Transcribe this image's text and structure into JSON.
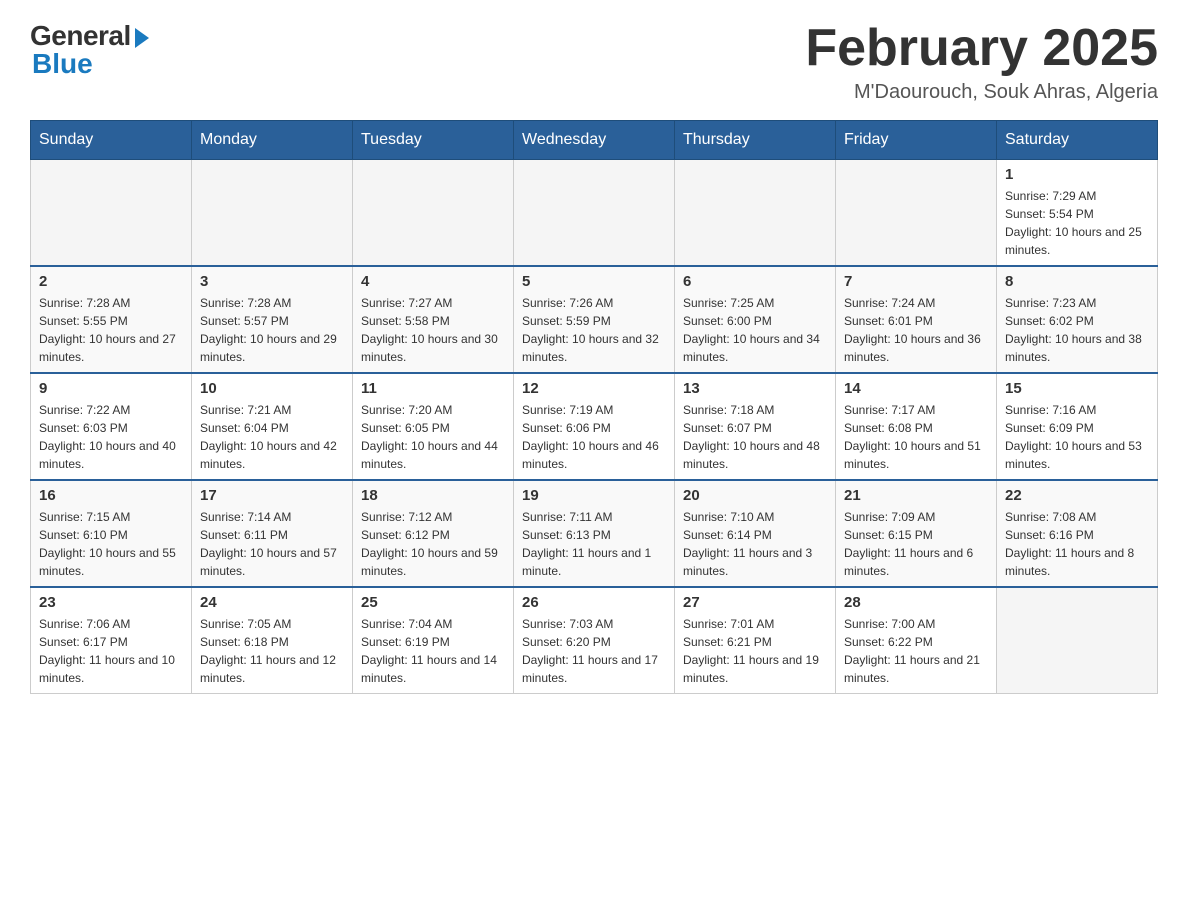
{
  "header": {
    "logo_general": "General",
    "logo_blue": "Blue",
    "main_title": "February 2025",
    "subtitle": "M'Daourouch, Souk Ahras, Algeria"
  },
  "days_of_week": [
    "Sunday",
    "Monday",
    "Tuesday",
    "Wednesday",
    "Thursday",
    "Friday",
    "Saturday"
  ],
  "weeks": [
    [
      {
        "day": "",
        "info": ""
      },
      {
        "day": "",
        "info": ""
      },
      {
        "day": "",
        "info": ""
      },
      {
        "day": "",
        "info": ""
      },
      {
        "day": "",
        "info": ""
      },
      {
        "day": "",
        "info": ""
      },
      {
        "day": "1",
        "info": "Sunrise: 7:29 AM\nSunset: 5:54 PM\nDaylight: 10 hours and 25 minutes."
      }
    ],
    [
      {
        "day": "2",
        "info": "Sunrise: 7:28 AM\nSunset: 5:55 PM\nDaylight: 10 hours and 27 minutes."
      },
      {
        "day": "3",
        "info": "Sunrise: 7:28 AM\nSunset: 5:57 PM\nDaylight: 10 hours and 29 minutes."
      },
      {
        "day": "4",
        "info": "Sunrise: 7:27 AM\nSunset: 5:58 PM\nDaylight: 10 hours and 30 minutes."
      },
      {
        "day": "5",
        "info": "Sunrise: 7:26 AM\nSunset: 5:59 PM\nDaylight: 10 hours and 32 minutes."
      },
      {
        "day": "6",
        "info": "Sunrise: 7:25 AM\nSunset: 6:00 PM\nDaylight: 10 hours and 34 minutes."
      },
      {
        "day": "7",
        "info": "Sunrise: 7:24 AM\nSunset: 6:01 PM\nDaylight: 10 hours and 36 minutes."
      },
      {
        "day": "8",
        "info": "Sunrise: 7:23 AM\nSunset: 6:02 PM\nDaylight: 10 hours and 38 minutes."
      }
    ],
    [
      {
        "day": "9",
        "info": "Sunrise: 7:22 AM\nSunset: 6:03 PM\nDaylight: 10 hours and 40 minutes."
      },
      {
        "day": "10",
        "info": "Sunrise: 7:21 AM\nSunset: 6:04 PM\nDaylight: 10 hours and 42 minutes."
      },
      {
        "day": "11",
        "info": "Sunrise: 7:20 AM\nSunset: 6:05 PM\nDaylight: 10 hours and 44 minutes."
      },
      {
        "day": "12",
        "info": "Sunrise: 7:19 AM\nSunset: 6:06 PM\nDaylight: 10 hours and 46 minutes."
      },
      {
        "day": "13",
        "info": "Sunrise: 7:18 AM\nSunset: 6:07 PM\nDaylight: 10 hours and 48 minutes."
      },
      {
        "day": "14",
        "info": "Sunrise: 7:17 AM\nSunset: 6:08 PM\nDaylight: 10 hours and 51 minutes."
      },
      {
        "day": "15",
        "info": "Sunrise: 7:16 AM\nSunset: 6:09 PM\nDaylight: 10 hours and 53 minutes."
      }
    ],
    [
      {
        "day": "16",
        "info": "Sunrise: 7:15 AM\nSunset: 6:10 PM\nDaylight: 10 hours and 55 minutes."
      },
      {
        "day": "17",
        "info": "Sunrise: 7:14 AM\nSunset: 6:11 PM\nDaylight: 10 hours and 57 minutes."
      },
      {
        "day": "18",
        "info": "Sunrise: 7:12 AM\nSunset: 6:12 PM\nDaylight: 10 hours and 59 minutes."
      },
      {
        "day": "19",
        "info": "Sunrise: 7:11 AM\nSunset: 6:13 PM\nDaylight: 11 hours and 1 minute."
      },
      {
        "day": "20",
        "info": "Sunrise: 7:10 AM\nSunset: 6:14 PM\nDaylight: 11 hours and 3 minutes."
      },
      {
        "day": "21",
        "info": "Sunrise: 7:09 AM\nSunset: 6:15 PM\nDaylight: 11 hours and 6 minutes."
      },
      {
        "day": "22",
        "info": "Sunrise: 7:08 AM\nSunset: 6:16 PM\nDaylight: 11 hours and 8 minutes."
      }
    ],
    [
      {
        "day": "23",
        "info": "Sunrise: 7:06 AM\nSunset: 6:17 PM\nDaylight: 11 hours and 10 minutes."
      },
      {
        "day": "24",
        "info": "Sunrise: 7:05 AM\nSunset: 6:18 PM\nDaylight: 11 hours and 12 minutes."
      },
      {
        "day": "25",
        "info": "Sunrise: 7:04 AM\nSunset: 6:19 PM\nDaylight: 11 hours and 14 minutes."
      },
      {
        "day": "26",
        "info": "Sunrise: 7:03 AM\nSunset: 6:20 PM\nDaylight: 11 hours and 17 minutes."
      },
      {
        "day": "27",
        "info": "Sunrise: 7:01 AM\nSunset: 6:21 PM\nDaylight: 11 hours and 19 minutes."
      },
      {
        "day": "28",
        "info": "Sunrise: 7:00 AM\nSunset: 6:22 PM\nDaylight: 11 hours and 21 minutes."
      },
      {
        "day": "",
        "info": ""
      }
    ]
  ]
}
